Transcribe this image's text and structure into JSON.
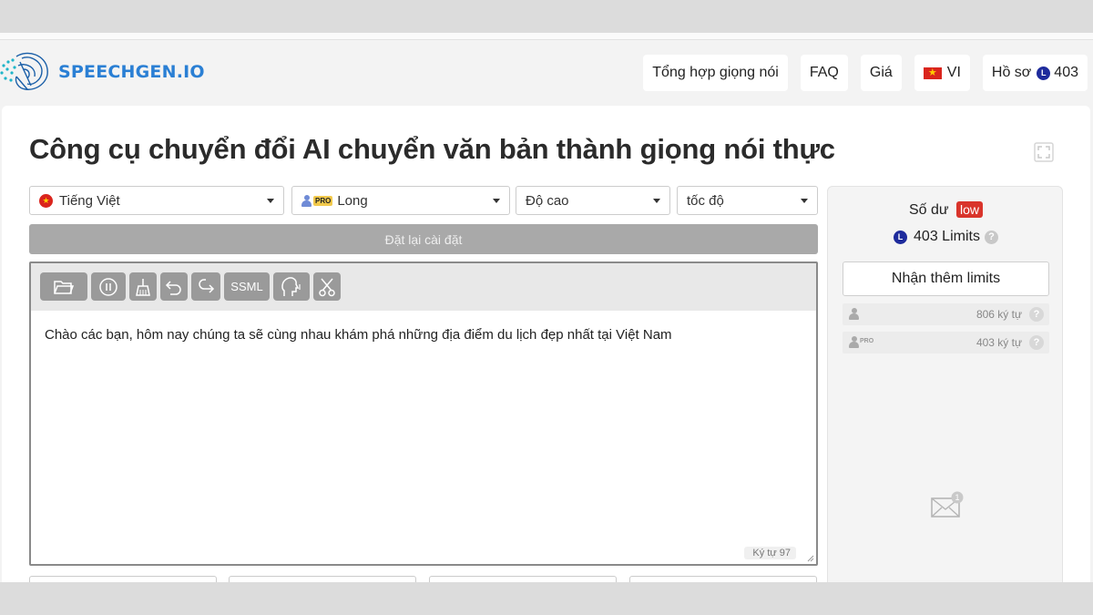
{
  "header": {
    "logo_text": "SPEECHGEN.IO",
    "nav": {
      "synth": "Tổng hợp giọng nói",
      "faq": "FAQ",
      "price": "Giá",
      "lang": "VI",
      "profile": "Hồ sơ",
      "coin_letter": "L",
      "profile_limits": "403"
    }
  },
  "main": {
    "title": "Công cụ chuyển đổi AI chuyển văn bản thành giọng nói thực",
    "selects": {
      "language": "Tiếng Việt",
      "voice_badge": "PRO",
      "voice": "Long",
      "pitch": "Độ cao",
      "speed": "tốc độ"
    },
    "reset_label": "Đặt lại cài đặt",
    "toolbar": {
      "ssml_label": "SSML"
    },
    "editor_text": "Chào các bạn, hôm nay chúng ta sẽ cùng nhau khám phá những địa điểm du lịch đẹp nhất tại Việt Nam",
    "char_count_label": "Ký tự",
    "char_count_value": "97"
  },
  "sidebar": {
    "balance_label": "Số dư",
    "balance_status": "low",
    "coin_letter": "L",
    "limits_text": "403 Limits",
    "help": "?",
    "get_more_label": "Nhận thêm limits",
    "quotas": [
      {
        "value": "806 ký tự",
        "pro": ""
      },
      {
        "value": "403 ký tự",
        "pro": "PRO"
      }
    ],
    "mail_badge": "1"
  },
  "colors": {
    "accent": "#2a7fd4",
    "low_badge": "#d9342b",
    "toolbar_button": "#9a9a9a",
    "reset_button": "#a9a9a9"
  }
}
